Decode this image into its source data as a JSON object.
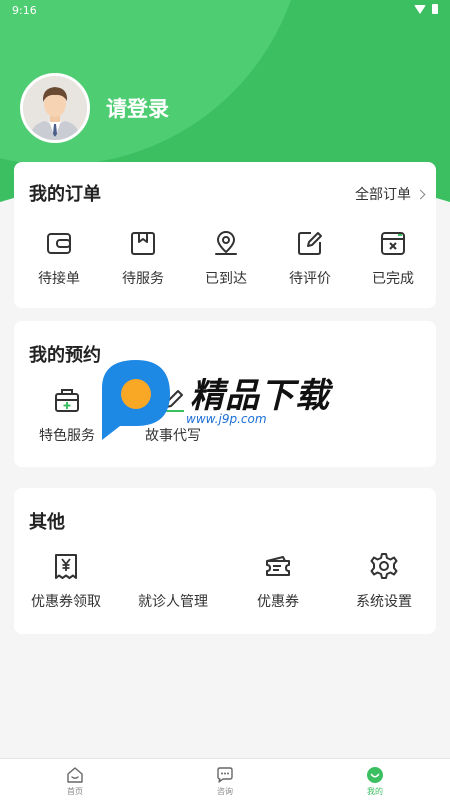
{
  "status_bar": {
    "time": "9:16"
  },
  "profile": {
    "login_label": "请登录"
  },
  "orders": {
    "title": "我的订单",
    "all_label": "全部订单",
    "items": [
      {
        "label": "待接单",
        "icon": "wallet-icon"
      },
      {
        "label": "待服务",
        "icon": "box-icon"
      },
      {
        "label": "已到达",
        "icon": "location-pin-icon"
      },
      {
        "label": "待评价",
        "icon": "edit-icon"
      },
      {
        "label": "已完成",
        "icon": "box-cancel-icon"
      }
    ]
  },
  "appointments": {
    "title": "我的预约",
    "items": [
      {
        "label": "特色服务",
        "icon": "medical-kit-icon"
      },
      {
        "label": "故事代写",
        "icon": "pen-icon"
      }
    ]
  },
  "other": {
    "title": "其他",
    "items": [
      {
        "label": "优惠券领取",
        "icon": "yen-receipt-icon"
      },
      {
        "label": "就诊人管理",
        "icon": "person-icon"
      },
      {
        "label": "优惠券",
        "icon": "ticket-icon"
      },
      {
        "label": "系统设置",
        "icon": "gear-icon"
      }
    ]
  },
  "watermark": {
    "text": "精品下载",
    "url": "www.j9p.com"
  },
  "tabbar": {
    "tabs": [
      {
        "label": "首页",
        "icon": "home-icon"
      },
      {
        "label": "咨询",
        "icon": "chat-icon"
      },
      {
        "label": "我的",
        "icon": "profile-icon"
      }
    ],
    "active_index": 2
  },
  "colors": {
    "brand_green": "#3cbf61",
    "light_green": "#4fcd72",
    "background": "#f5f5f5"
  }
}
